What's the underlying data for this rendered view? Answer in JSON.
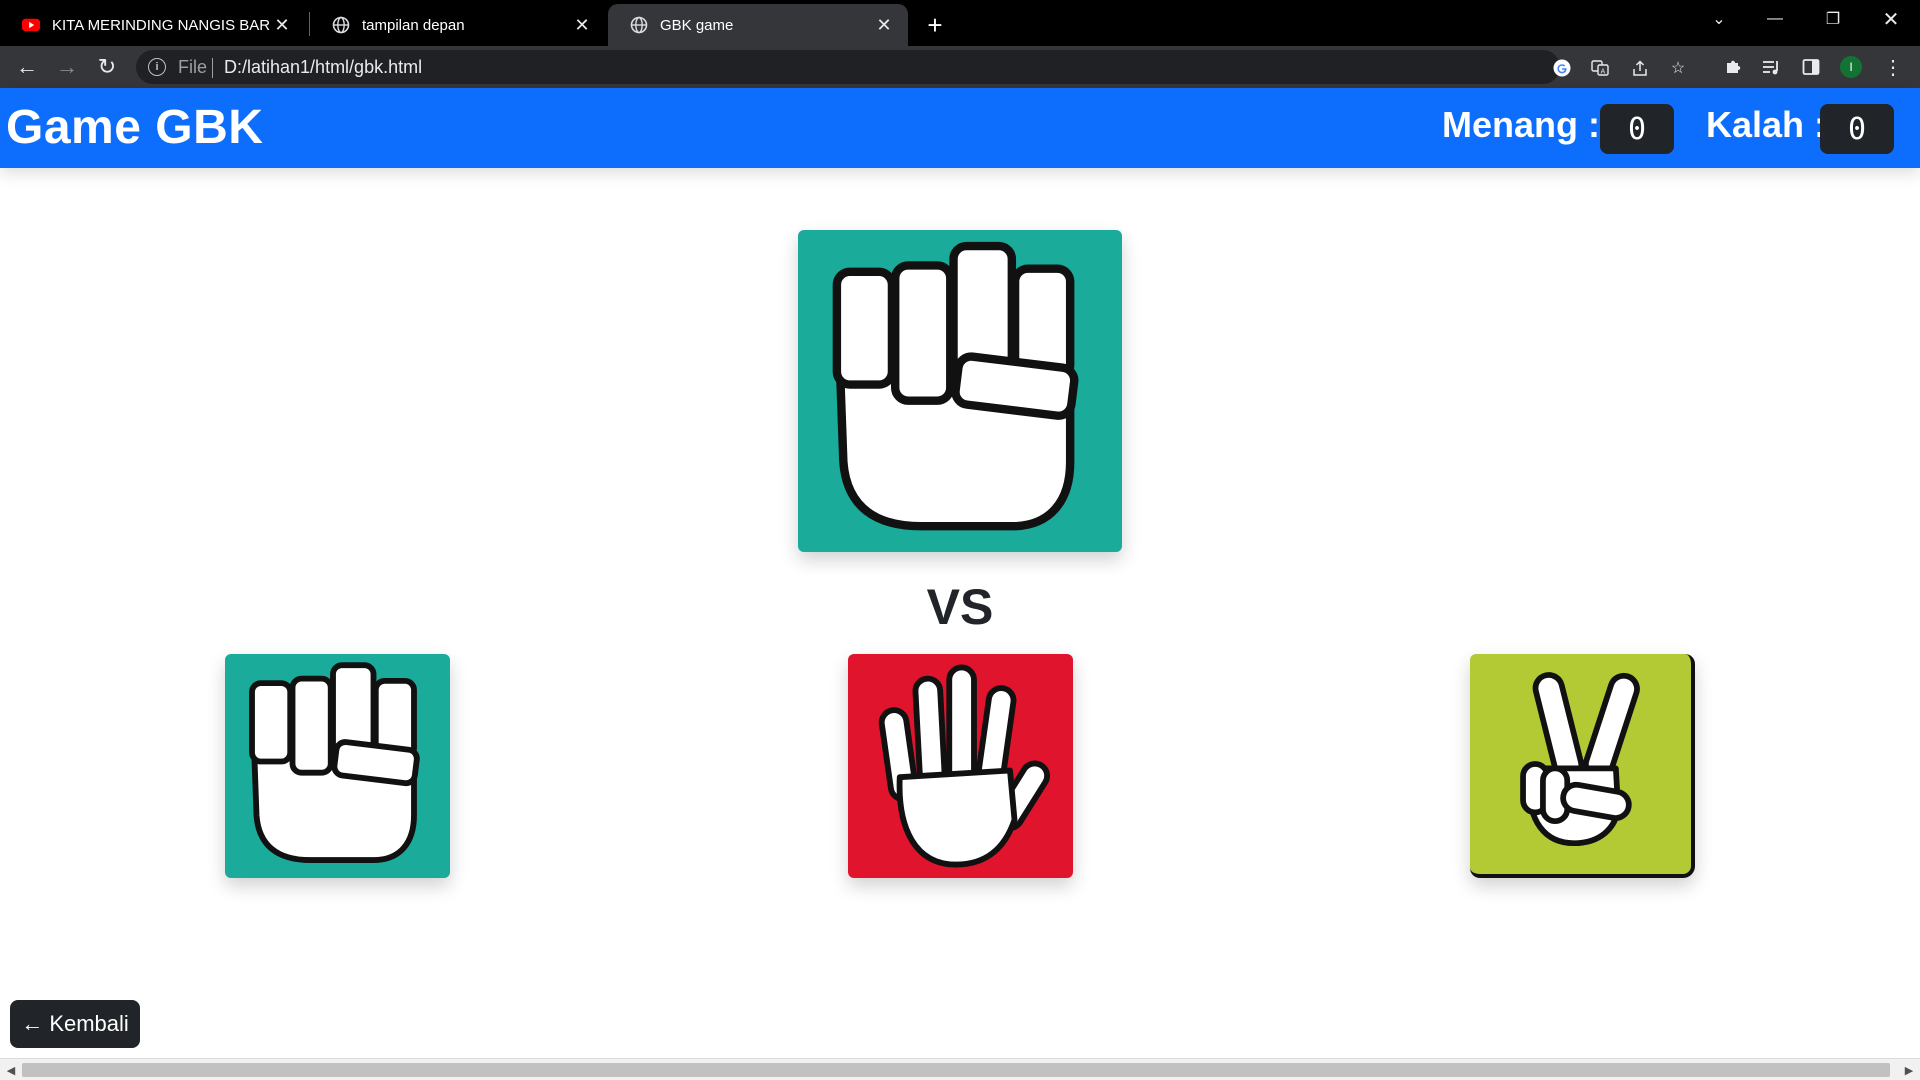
{
  "browser": {
    "tabs": [
      {
        "title": "KITA MERINDING NANGIS BAREN",
        "icon": "youtube-icon",
        "active": false
      },
      {
        "title": "tampilan depan",
        "icon": "globe-icon",
        "active": false
      },
      {
        "title": "GBK game",
        "icon": "globe-icon",
        "active": true
      }
    ],
    "address": {
      "scheme": "File",
      "url": "D:/latihan1/html/gbk.html"
    },
    "profile_initial": "I"
  },
  "navbar": {
    "brand": "Game GBK",
    "win_label": "Menang :",
    "win_value": "0",
    "lose_label": "Kalah :",
    "lose_value": "0",
    "color": "#0d6efd"
  },
  "game": {
    "computer_choice": {
      "name": "batu",
      "icon": "fist-rock-icon",
      "color": "#1aab9b"
    },
    "vs_text": "VS",
    "player_choices": [
      {
        "name": "batu",
        "icon": "fist-rock-icon",
        "color": "#1aab9b"
      },
      {
        "name": "kertas",
        "icon": "open-hand-paper-icon",
        "color": "#e1142e"
      },
      {
        "name": "gunting",
        "icon": "peace-scissors-icon",
        "color": "#b4ca35"
      }
    ]
  },
  "back_button": {
    "label": "← Kembali"
  }
}
